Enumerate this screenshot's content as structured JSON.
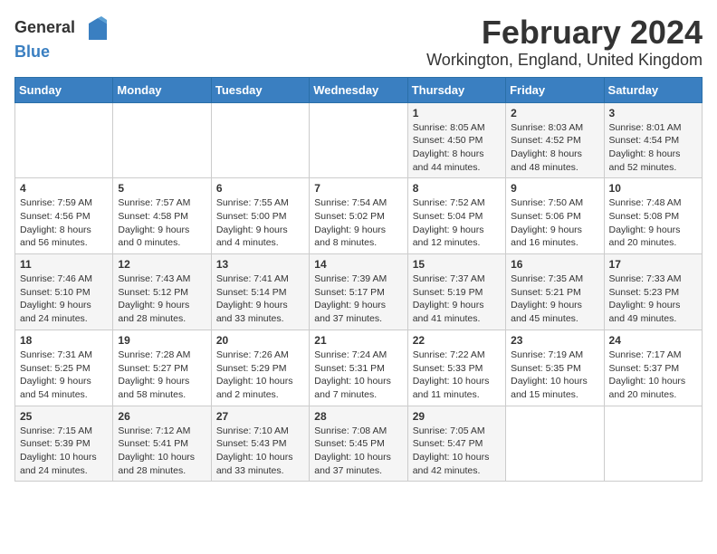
{
  "logo": {
    "general": "General",
    "blue": "Blue"
  },
  "title": "February 2024",
  "subtitle": "Workington, England, United Kingdom",
  "days_of_week": [
    "Sunday",
    "Monday",
    "Tuesday",
    "Wednesday",
    "Thursday",
    "Friday",
    "Saturday"
  ],
  "weeks": [
    [
      {
        "day": "",
        "sunrise": "",
        "sunset": "",
        "daylight": ""
      },
      {
        "day": "",
        "sunrise": "",
        "sunset": "",
        "daylight": ""
      },
      {
        "day": "",
        "sunrise": "",
        "sunset": "",
        "daylight": ""
      },
      {
        "day": "",
        "sunrise": "",
        "sunset": "",
        "daylight": ""
      },
      {
        "day": "1",
        "sunrise": "Sunrise: 8:05 AM",
        "sunset": "Sunset: 4:50 PM",
        "daylight": "Daylight: 8 hours and 44 minutes."
      },
      {
        "day": "2",
        "sunrise": "Sunrise: 8:03 AM",
        "sunset": "Sunset: 4:52 PM",
        "daylight": "Daylight: 8 hours and 48 minutes."
      },
      {
        "day": "3",
        "sunrise": "Sunrise: 8:01 AM",
        "sunset": "Sunset: 4:54 PM",
        "daylight": "Daylight: 8 hours and 52 minutes."
      }
    ],
    [
      {
        "day": "4",
        "sunrise": "Sunrise: 7:59 AM",
        "sunset": "Sunset: 4:56 PM",
        "daylight": "Daylight: 8 hours and 56 minutes."
      },
      {
        "day": "5",
        "sunrise": "Sunrise: 7:57 AM",
        "sunset": "Sunset: 4:58 PM",
        "daylight": "Daylight: 9 hours and 0 minutes."
      },
      {
        "day": "6",
        "sunrise": "Sunrise: 7:55 AM",
        "sunset": "Sunset: 5:00 PM",
        "daylight": "Daylight: 9 hours and 4 minutes."
      },
      {
        "day": "7",
        "sunrise": "Sunrise: 7:54 AM",
        "sunset": "Sunset: 5:02 PM",
        "daylight": "Daylight: 9 hours and 8 minutes."
      },
      {
        "day": "8",
        "sunrise": "Sunrise: 7:52 AM",
        "sunset": "Sunset: 5:04 PM",
        "daylight": "Daylight: 9 hours and 12 minutes."
      },
      {
        "day": "9",
        "sunrise": "Sunrise: 7:50 AM",
        "sunset": "Sunset: 5:06 PM",
        "daylight": "Daylight: 9 hours and 16 minutes."
      },
      {
        "day": "10",
        "sunrise": "Sunrise: 7:48 AM",
        "sunset": "Sunset: 5:08 PM",
        "daylight": "Daylight: 9 hours and 20 minutes."
      }
    ],
    [
      {
        "day": "11",
        "sunrise": "Sunrise: 7:46 AM",
        "sunset": "Sunset: 5:10 PM",
        "daylight": "Daylight: 9 hours and 24 minutes."
      },
      {
        "day": "12",
        "sunrise": "Sunrise: 7:43 AM",
        "sunset": "Sunset: 5:12 PM",
        "daylight": "Daylight: 9 hours and 28 minutes."
      },
      {
        "day": "13",
        "sunrise": "Sunrise: 7:41 AM",
        "sunset": "Sunset: 5:14 PM",
        "daylight": "Daylight: 9 hours and 33 minutes."
      },
      {
        "day": "14",
        "sunrise": "Sunrise: 7:39 AM",
        "sunset": "Sunset: 5:17 PM",
        "daylight": "Daylight: 9 hours and 37 minutes."
      },
      {
        "day": "15",
        "sunrise": "Sunrise: 7:37 AM",
        "sunset": "Sunset: 5:19 PM",
        "daylight": "Daylight: 9 hours and 41 minutes."
      },
      {
        "day": "16",
        "sunrise": "Sunrise: 7:35 AM",
        "sunset": "Sunset: 5:21 PM",
        "daylight": "Daylight: 9 hours and 45 minutes."
      },
      {
        "day": "17",
        "sunrise": "Sunrise: 7:33 AM",
        "sunset": "Sunset: 5:23 PM",
        "daylight": "Daylight: 9 hours and 49 minutes."
      }
    ],
    [
      {
        "day": "18",
        "sunrise": "Sunrise: 7:31 AM",
        "sunset": "Sunset: 5:25 PM",
        "daylight": "Daylight: 9 hours and 54 minutes."
      },
      {
        "day": "19",
        "sunrise": "Sunrise: 7:28 AM",
        "sunset": "Sunset: 5:27 PM",
        "daylight": "Daylight: 9 hours and 58 minutes."
      },
      {
        "day": "20",
        "sunrise": "Sunrise: 7:26 AM",
        "sunset": "Sunset: 5:29 PM",
        "daylight": "Daylight: 10 hours and 2 minutes."
      },
      {
        "day": "21",
        "sunrise": "Sunrise: 7:24 AM",
        "sunset": "Sunset: 5:31 PM",
        "daylight": "Daylight: 10 hours and 7 minutes."
      },
      {
        "day": "22",
        "sunrise": "Sunrise: 7:22 AM",
        "sunset": "Sunset: 5:33 PM",
        "daylight": "Daylight: 10 hours and 11 minutes."
      },
      {
        "day": "23",
        "sunrise": "Sunrise: 7:19 AM",
        "sunset": "Sunset: 5:35 PM",
        "daylight": "Daylight: 10 hours and 15 minutes."
      },
      {
        "day": "24",
        "sunrise": "Sunrise: 7:17 AM",
        "sunset": "Sunset: 5:37 PM",
        "daylight": "Daylight: 10 hours and 20 minutes."
      }
    ],
    [
      {
        "day": "25",
        "sunrise": "Sunrise: 7:15 AM",
        "sunset": "Sunset: 5:39 PM",
        "daylight": "Daylight: 10 hours and 24 minutes."
      },
      {
        "day": "26",
        "sunrise": "Sunrise: 7:12 AM",
        "sunset": "Sunset: 5:41 PM",
        "daylight": "Daylight: 10 hours and 28 minutes."
      },
      {
        "day": "27",
        "sunrise": "Sunrise: 7:10 AM",
        "sunset": "Sunset: 5:43 PM",
        "daylight": "Daylight: 10 hours and 33 minutes."
      },
      {
        "day": "28",
        "sunrise": "Sunrise: 7:08 AM",
        "sunset": "Sunset: 5:45 PM",
        "daylight": "Daylight: 10 hours and 37 minutes."
      },
      {
        "day": "29",
        "sunrise": "Sunrise: 7:05 AM",
        "sunset": "Sunset: 5:47 PM",
        "daylight": "Daylight: 10 hours and 42 minutes."
      },
      {
        "day": "",
        "sunrise": "",
        "sunset": "",
        "daylight": ""
      },
      {
        "day": "",
        "sunrise": "",
        "sunset": "",
        "daylight": ""
      }
    ]
  ]
}
